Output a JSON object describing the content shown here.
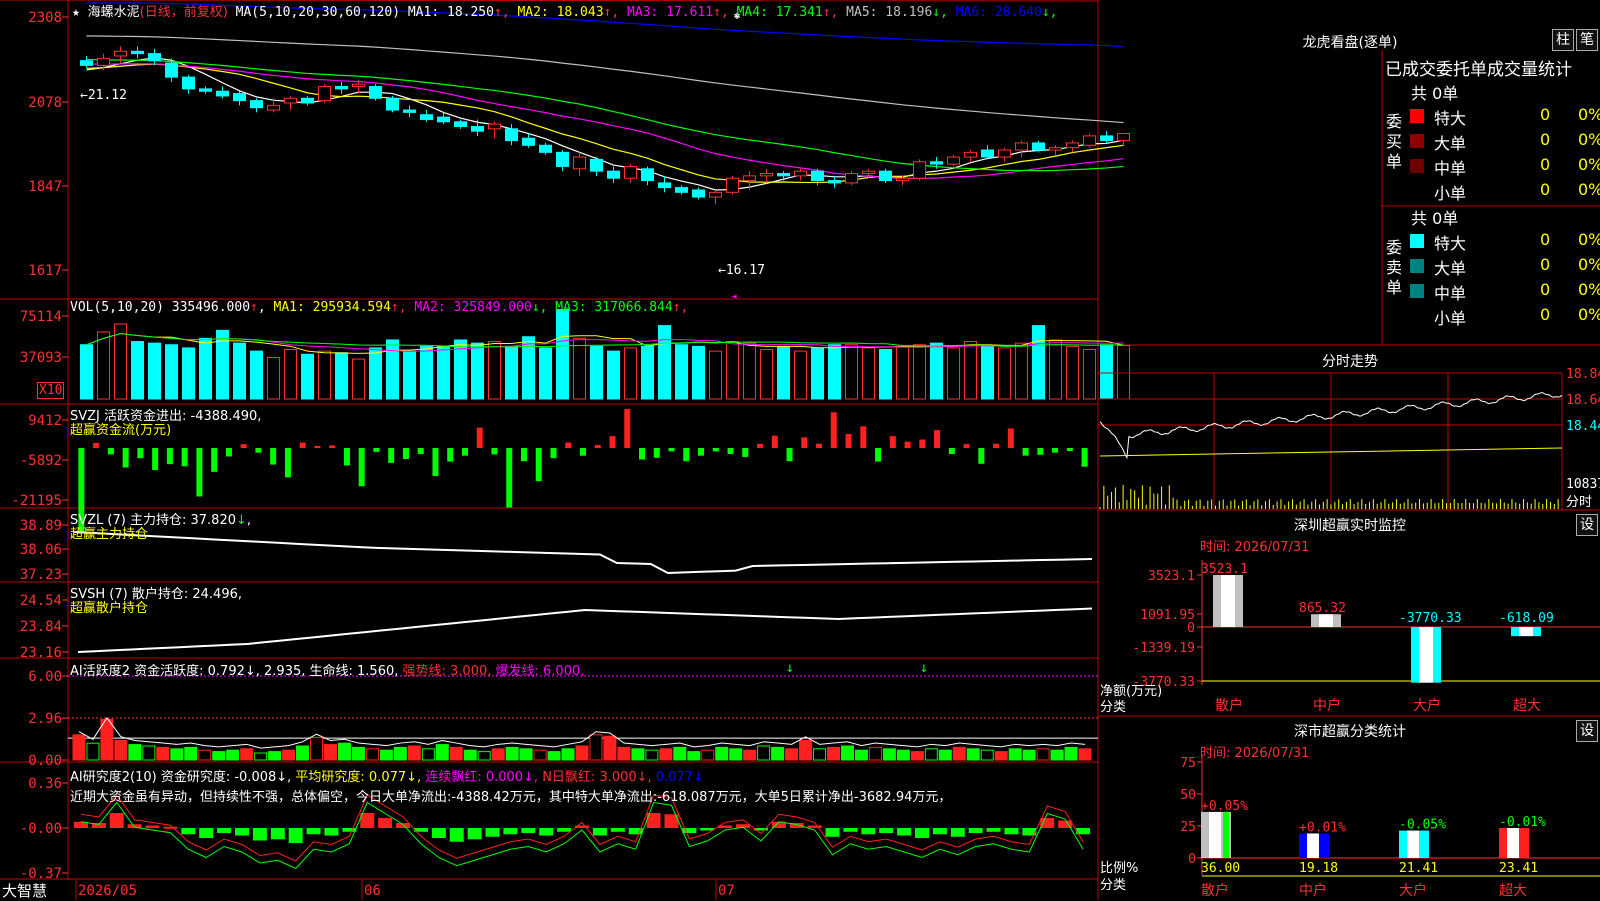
{
  "stock": {
    "name": "海螺水泥",
    "period": "(日线，前复权)"
  },
  "colors": {
    "up": "#ff3030",
    "down": "#00ffff",
    "bg": "#000000",
    "grid": "#c00000",
    "ma1": "#ffffff",
    "ma2": "#ffff00",
    "ma3": "#ff00ff",
    "ma4": "#00ff00",
    "ma5": "#c0c0c0",
    "ma6": "#0000ff"
  },
  "main_panel": {
    "indicator": "MA(5,10,20,30,60,120)",
    "items": [
      {
        "label": "MA1:",
        "value": "18.250",
        "arrow": "↑",
        "color": "#ffffff"
      },
      {
        "label": "MA2:",
        "value": "18.043",
        "arrow": "↑",
        "color": "#ffff00"
      },
      {
        "label": "MA3:",
        "value": "17.611",
        "arrow": "↑",
        "color": "#ff00ff"
      },
      {
        "label": "MA4:",
        "value": "17.341",
        "arrow": "↑",
        "color": "#00ff00"
      },
      {
        "label": "MA5:",
        "value": "18.196",
        "arrow": "↓",
        "color": "#c0c0c0"
      },
      {
        "label": "MA6:",
        "value": "20.640",
        "arrow": "↓",
        "color": "#0000ff"
      }
    ],
    "y_ticks": [
      "2308",
      "2078",
      "1847",
      "1617"
    ],
    "high_label": "←21.12",
    "low_label": "←16.17"
  },
  "vol_panel": {
    "indicator": "VOL(5,10,20)",
    "value": "335496.000",
    "items": [
      {
        "label": "MA1:",
        "value": "295934.594",
        "arrow": "↑",
        "color": "#ffff00"
      },
      {
        "label": "MA2:",
        "value": "325849.000",
        "arrow": "↓",
        "color": "#ff00ff"
      },
      {
        "label": "MA3:",
        "value": "317066.844",
        "arrow": "↑",
        "color": "#00ff00"
      }
    ],
    "y_ticks": [
      "75114",
      "37093"
    ],
    "unit": "X10"
  },
  "svzj_panel": {
    "title": "SVZJ  活跃资金进出:",
    "value": "-4388.490",
    "subtitle": "超赢资金流(万元)",
    "y_ticks": [
      "9412",
      "-5892",
      "-21195"
    ]
  },
  "svzl_panel": {
    "title": "SVZL (7) 主力持仓:",
    "value": "37.820",
    "subtitle": "超赢主力持仓",
    "y_ticks": [
      "38.89",
      "38.06",
      "37.23"
    ]
  },
  "svsh_panel": {
    "title": "SVSH (7) 散户持仓:",
    "value": "24.496",
    "subtitle": "超赢散户持仓",
    "y_ticks": [
      "24.54",
      "23.84",
      "23.16"
    ]
  },
  "ai1_panel": {
    "title": "AI活跃度2 资金活跃度:",
    "items": [
      {
        "text": "0.792↓,",
        "color": "#ffffff"
      },
      {
        "text": "2.935,",
        "color": "#ffffff"
      },
      {
        "text": "生命线: 1.560,",
        "color": "#ffffff"
      },
      {
        "text": "强势线: 3.000,",
        "color": "#ff3030"
      },
      {
        "text": "爆发线: 6.000,",
        "color": "#ff00ff"
      }
    ],
    "y_ticks": [
      "6.00",
      "2.96",
      "0.00"
    ]
  },
  "ai2_panel": {
    "title": "AI研究度2(10) 资金研究度:",
    "items": [
      {
        "text": "-0.008↓,",
        "color": "#ffffff"
      },
      {
        "text": "平均研究度: 0.077↓,",
        "color": "#ffff00"
      },
      {
        "text": "连续飘红: 0.000↓,",
        "color": "#ff00ff"
      },
      {
        "text": "N日飘红: 3.000↓,",
        "color": "#ff3030"
      },
      {
        "text": "0.077↓",
        "color": "#0000ff"
      }
    ],
    "commentary": "近期大资金虽有异动，但持续性不强，总体偏空，今日大单净流出:-4388.42万元，其中特大单净流出:-618.087万元，大单5日累计净出-3682.94万元，",
    "y_ticks": [
      "0.36",
      "-0.00",
      "-0.37"
    ]
  },
  "x_axis": {
    "labels": [
      "2026/05",
      "06",
      "07"
    ]
  },
  "bottom_logo": "大智慧",
  "dragon_tiger": {
    "title": "龙虎看盘(逐单)",
    "tabs": [
      "柱",
      "笔"
    ],
    "header": "已成交委托单成交量统计",
    "buy": {
      "label": "委买单",
      "total": "共 0单",
      "rows": [
        {
          "name": "特大",
          "count": "0",
          "pct": "0%",
          "color": "#ff0000"
        },
        {
          "name": "大单",
          "count": "0",
          "pct": "0%",
          "color": "#900000"
        },
        {
          "name": "中单",
          "count": "0",
          "pct": "0%",
          "color": "#700000"
        },
        {
          "name": "小单",
          "count": "0",
          "pct": "0%",
          "color": ""
        }
      ]
    },
    "sell": {
      "label": "委卖单",
      "total": "共 0单",
      "rows": [
        {
          "name": "特大",
          "count": "0",
          "pct": "0%",
          "color": "#00ffff"
        },
        {
          "name": "大单",
          "count": "0",
          "pct": "0%",
          "color": "#008080"
        },
        {
          "name": "中单",
          "count": "0",
          "pct": "0%",
          "color": "#008080"
        },
        {
          "name": "小单",
          "count": "0",
          "pct": "0%",
          "color": ""
        }
      ]
    }
  },
  "intraday": {
    "title": "分时走势",
    "y_ticks": [
      "18.84",
      "18.64",
      "18.44"
    ],
    "vol_tick": "10837",
    "vol_unit": "分时"
  },
  "monitor": {
    "title": "深圳超赢实时监控",
    "settings": "设",
    "time": "时间: 2026/07/31",
    "y_ticks": [
      "3523.1",
      "1091.95",
      "0",
      "-1339.19",
      "-3770.33"
    ],
    "ylabel": "净额(万元)",
    "xlabel": "分类",
    "categories": [
      "散户",
      "中户",
      "大户",
      "超大"
    ],
    "values": [
      3523.1,
      865.32,
      -3770.33,
      -618.09
    ],
    "value_labels": [
      "3523.1",
      "865.32",
      "-3770.33",
      "-618.09"
    ]
  },
  "stats": {
    "title": "深市超赢分类统计",
    "settings": "设",
    "time": "时间: 2026/07/31",
    "y_ticks": [
      "75",
      "50",
      "25",
      "0"
    ],
    "ylabel": "比例%",
    "xlabel": "分类",
    "categories": [
      "散户",
      "中户",
      "大户",
      "超大"
    ],
    "values": [
      36.0,
      19.18,
      21.41,
      23.41
    ],
    "value_labels": [
      "36.00",
      "19.18",
      "21.41",
      "23.41"
    ],
    "change_labels": [
      "+0.05%",
      "+0.01%",
      "-0.05%",
      "-0.01%"
    ]
  },
  "chart_data": [
    {
      "type": "candlestick",
      "title": "海螺水泥",
      "ylim": [
        16.17,
        21.12
      ],
      "ohlc": [
        [
          20.65,
          20.75,
          20.5,
          20.55
        ],
        [
          20.55,
          20.8,
          20.45,
          20.7
        ],
        [
          20.75,
          20.95,
          20.6,
          20.85
        ],
        [
          20.85,
          20.95,
          20.7,
          20.8
        ],
        [
          20.8,
          20.9,
          20.55,
          20.65
        ],
        [
          20.6,
          20.7,
          20.2,
          20.3
        ],
        [
          20.3,
          20.35,
          19.95,
          20.05
        ],
        [
          20.05,
          20.1,
          19.95,
          20.0
        ],
        [
          20.0,
          20.1,
          19.85,
          19.9
        ],
        [
          19.95,
          20.0,
          19.7,
          19.8
        ],
        [
          19.8,
          19.85,
          19.55,
          19.65
        ],
        [
          19.6,
          19.85,
          19.55,
          19.7
        ],
        [
          19.75,
          19.9,
          19.6,
          19.85
        ],
        [
          19.85,
          19.9,
          19.7,
          19.75
        ],
        [
          19.8,
          20.15,
          19.75,
          20.1
        ],
        [
          20.1,
          20.2,
          19.95,
          20.05
        ],
        [
          20.1,
          20.25,
          19.95,
          20.15
        ],
        [
          20.1,
          20.15,
          19.8,
          19.85
        ],
        [
          19.85,
          19.9,
          19.55,
          19.6
        ],
        [
          19.6,
          19.7,
          19.45,
          19.55
        ],
        [
          19.5,
          19.6,
          19.35,
          19.4
        ],
        [
          19.45,
          19.55,
          19.3,
          19.35
        ],
        [
          19.35,
          19.4,
          19.2,
          19.25
        ],
        [
          19.25,
          19.4,
          19.05,
          19.15
        ],
        [
          19.2,
          19.35,
          19.0,
          19.3
        ],
        [
          19.2,
          19.3,
          18.85,
          18.95
        ],
        [
          19.0,
          19.1,
          18.8,
          18.85
        ],
        [
          18.85,
          18.9,
          18.65,
          18.7
        ],
        [
          18.7,
          18.75,
          18.3,
          18.4
        ],
        [
          18.35,
          18.7,
          18.2,
          18.6
        ],
        [
          18.55,
          18.6,
          18.2,
          18.3
        ],
        [
          18.3,
          18.4,
          18.05,
          18.15
        ],
        [
          18.15,
          18.45,
          18.05,
          18.4
        ],
        [
          18.35,
          18.4,
          18.0,
          18.1
        ],
        [
          18.05,
          18.2,
          17.85,
          17.95
        ],
        [
          17.95,
          18.0,
          17.8,
          17.85
        ],
        [
          17.9,
          17.95,
          17.7,
          17.75
        ],
        [
          17.75,
          17.9,
          17.6,
          17.85
        ],
        [
          17.85,
          18.2,
          17.8,
          18.15
        ],
        [
          18.1,
          18.3,
          17.9,
          18.2
        ],
        [
          18.2,
          18.35,
          18.05,
          18.25
        ],
        [
          18.25,
          18.3,
          18.1,
          18.2
        ],
        [
          18.2,
          18.35,
          18.1,
          18.3
        ],
        [
          18.3,
          18.35,
          18.0,
          18.1
        ],
        [
          18.1,
          18.2,
          17.95,
          18.05
        ],
        [
          18.05,
          18.3,
          18.0,
          18.25
        ],
        [
          18.25,
          18.35,
          18.15,
          18.3
        ],
        [
          18.3,
          18.35,
          18.05,
          18.1
        ],
        [
          18.1,
          18.2,
          18.0,
          18.15
        ],
        [
          18.15,
          18.55,
          18.1,
          18.5
        ],
        [
          18.5,
          18.6,
          18.35,
          18.45
        ],
        [
          18.45,
          18.65,
          18.4,
          18.6
        ],
        [
          18.6,
          18.75,
          18.5,
          18.7
        ],
        [
          18.75,
          18.85,
          18.55,
          18.6
        ],
        [
          18.6,
          18.8,
          18.5,
          18.75
        ],
        [
          18.75,
          18.95,
          18.6,
          18.9
        ],
        [
          18.9,
          18.95,
          18.7,
          18.75
        ],
        [
          18.75,
          18.85,
          18.65,
          18.8
        ],
        [
          18.8,
          18.95,
          18.7,
          18.9
        ],
        [
          18.85,
          19.1,
          18.8,
          19.05
        ],
        [
          19.05,
          19.15,
          18.9,
          18.95
        ],
        [
          18.95,
          19.1,
          18.85,
          19.1
        ]
      ]
    },
    {
      "type": "bar",
      "title": "VOL(5,10,20)",
      "values": [
        340,
        420,
        470,
        360,
        350,
        340,
        320,
        380,
        430,
        350,
        300,
        260,
        310,
        280,
        300,
        290,
        250,
        320,
        370,
        300,
        330,
        330,
        370,
        350,
        360,
        330,
        390,
        320,
        560,
        380,
        330,
        300,
        320,
        330,
        460,
        340,
        330,
        300,
        360,
        350,
        310,
        330,
        300,
        320,
        340,
        340,
        320,
        310,
        330,
        340,
        350,
        320,
        360,
        330,
        320,
        350,
        460,
        370,
        330,
        310,
        340,
        335
      ]
    },
    {
      "type": "bar",
      "title": "SVZJ",
      "values": [
        -20000,
        1200,
        -1500,
        -4600,
        -2400,
        -5200,
        -3800,
        -4300,
        -11400,
        -5600,
        -2000,
        900,
        -1100,
        -3900,
        -6900,
        1300,
        500,
        600,
        -4100,
        -9000,
        -900,
        -3500,
        -2600,
        -1400,
        -6600,
        -3200,
        -1800,
        4800,
        -1500,
        -14000,
        -3100,
        -7800,
        -2400,
        1300,
        -1800,
        700,
        2800,
        9200,
        -2700,
        -2300,
        -800,
        -3100,
        -1800,
        -800,
        -1400,
        -2100,
        1000,
        2900,
        -3100,
        2500,
        1000,
        8400,
        3300,
        5100,
        -3200,
        2800,
        1500,
        2000,
        4200,
        -1400,
        900,
        -3700,
        1000,
        4600,
        -1800,
        -1600,
        -1100,
        -700,
        -4400
      ]
    },
    {
      "type": "line",
      "title": "SVZL",
      "ylim": [
        37.23,
        38.89
      ]
    },
    {
      "type": "line",
      "title": "SVSH",
      "ylim": [
        23.16,
        24.54
      ]
    },
    {
      "type": "bar",
      "title": "AI活跃度2",
      "ylim": [
        0,
        6
      ],
      "values": [
        1.8,
        1.2,
        2.9,
        1.4,
        1.1,
        1.0,
        0.9,
        0.8,
        0.9,
        0.7,
        0.6,
        0.7,
        0.8,
        0.5,
        0.6,
        0.7,
        1.0,
        1.6,
        1.1,
        1.2,
        0.9,
        0.8,
        0.7,
        0.9,
        1.0,
        0.8,
        1.1,
        0.9,
        0.7,
        0.6,
        0.8,
        0.9,
        0.8,
        0.7,
        0.6,
        0.8,
        1.0,
        1.8,
        1.7,
        0.9,
        0.8,
        0.7,
        0.8,
        0.9,
        0.6,
        0.7,
        0.9,
        0.8,
        0.7,
        1.0,
        0.9,
        0.8,
        1.4,
        0.8,
        0.9,
        1.0,
        0.7,
        0.9,
        0.8,
        0.7,
        0.6,
        0.8,
        0.7,
        0.9,
        0.8,
        0.7,
        0.6,
        0.8,
        0.7,
        0.8,
        0.7,
        0.9,
        0.8
      ]
    },
    {
      "type": "bar",
      "title": "AI研究度2(10)",
      "ylim": [
        -0.37,
        0.36
      ],
      "values": [
        0.05,
        0.04,
        0.12,
        0.03,
        0.02,
        0.01,
        -0.05,
        -0.08,
        -0.04,
        -0.06,
        -0.1,
        -0.09,
        -0.12,
        -0.05,
        -0.06,
        -0.03,
        0.12,
        0.08,
        0.04,
        -0.03,
        -0.08,
        -0.11,
        -0.09,
        -0.07,
        -0.05,
        -0.04,
        -0.06,
        -0.03,
        0.02,
        -0.06,
        -0.03,
        -0.05,
        0.12,
        0.11,
        -0.04,
        -0.02,
        0.02,
        0.03,
        -0.02,
        0.05,
        0.04,
        0.02,
        -0.07,
        -0.03,
        -0.05,
        -0.04,
        -0.06,
        -0.08,
        -0.05,
        -0.07,
        -0.04,
        -0.03,
        -0.05,
        -0.06,
        0.08,
        0.06,
        -0.05
      ]
    }
  ]
}
